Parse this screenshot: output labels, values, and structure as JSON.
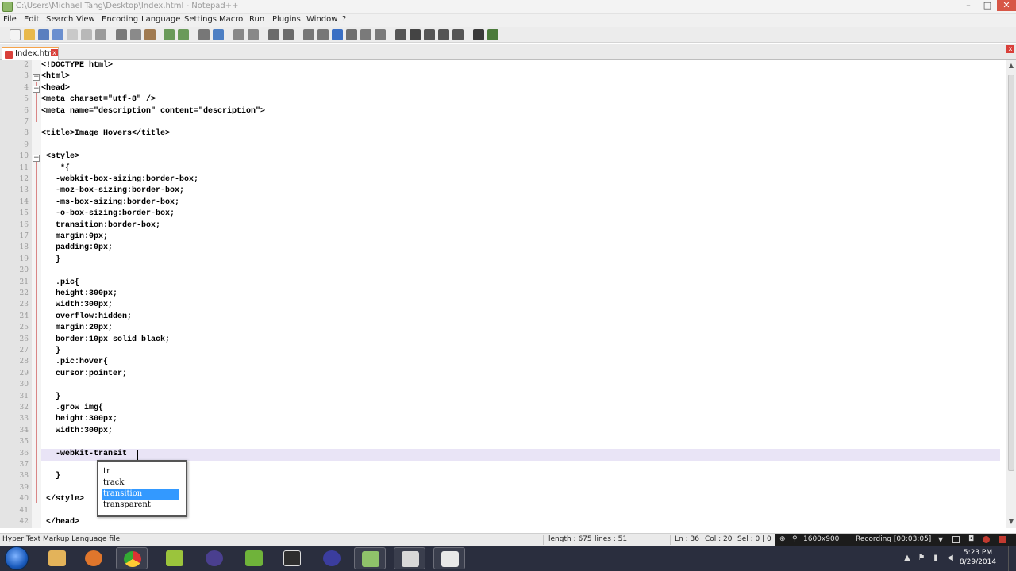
{
  "window": {
    "title": "C:\\Users\\Michael Tang\\Desktop\\Index.html - Notepad++"
  },
  "menu": [
    "File",
    "Edit",
    "Search",
    "View",
    "Encoding",
    "Language",
    "Settings",
    "Macro",
    "Run",
    "Plugins",
    "Window",
    "?"
  ],
  "tab": {
    "label": "Index.html",
    "close": "x"
  },
  "editor": {
    "lines": [
      {
        "num": "2",
        "text": "<!DOCTYPE html>"
      },
      {
        "num": "3",
        "text": "<html>"
      },
      {
        "num": "4",
        "text": "<head>"
      },
      {
        "num": "5",
        "text": "<meta charset=\"utf-8\" />"
      },
      {
        "num": "6",
        "text": "<meta name=\"description\" content=\"description\">"
      },
      {
        "num": "7",
        "text": ""
      },
      {
        "num": "8",
        "text": "<title>Image Hovers</title>"
      },
      {
        "num": "9",
        "text": ""
      },
      {
        "num": "10",
        "text": " <style>"
      },
      {
        "num": "11",
        "text": "    *{"
      },
      {
        "num": "12",
        "text": "   -webkit-box-sizing:border-box;"
      },
      {
        "num": "13",
        "text": "   -moz-box-sizing:border-box;"
      },
      {
        "num": "14",
        "text": "   -ms-box-sizing:border-box;"
      },
      {
        "num": "15",
        "text": "   -o-box-sizing:border-box;"
      },
      {
        "num": "16",
        "text": "   transition:border-box;"
      },
      {
        "num": "17",
        "text": "   margin:0px;"
      },
      {
        "num": "18",
        "text": "   padding:0px;"
      },
      {
        "num": "19",
        "text": "   }"
      },
      {
        "num": "20",
        "text": ""
      },
      {
        "num": "21",
        "text": "   .pic{"
      },
      {
        "num": "22",
        "text": "   height:300px;"
      },
      {
        "num": "23",
        "text": "   width:300px;"
      },
      {
        "num": "24",
        "text": "   overflow:hidden;"
      },
      {
        "num": "25",
        "text": "   margin:20px;"
      },
      {
        "num": "26",
        "text": "   border:10px solid black;"
      },
      {
        "num": "27",
        "text": "   }"
      },
      {
        "num": "28",
        "text": "   .pic:hover{"
      },
      {
        "num": "29",
        "text": "   cursor:pointer;"
      },
      {
        "num": "30",
        "text": ""
      },
      {
        "num": "31",
        "text": "   }"
      },
      {
        "num": "32",
        "text": "   .grow img{"
      },
      {
        "num": "33",
        "text": "   height:300px;"
      },
      {
        "num": "34",
        "text": "   width:300px;"
      },
      {
        "num": "35",
        "text": ""
      },
      {
        "num": "36",
        "text": "   -webkit-transit"
      },
      {
        "num": "37",
        "text": ""
      },
      {
        "num": "38",
        "text": "   }"
      },
      {
        "num": "39",
        "text": ""
      },
      {
        "num": "40",
        "text": " </style>"
      },
      {
        "num": "41",
        "text": ""
      },
      {
        "num": "42",
        "text": " </head>"
      }
    ]
  },
  "autocomplete": {
    "items": [
      "tr",
      "track",
      "transition",
      "transparent"
    ],
    "selected": "transition"
  },
  "status": {
    "file_type": "Hyper Text Markup Language file",
    "length": "length : 675",
    "lines": "lines : 51",
    "position": "Ln : 36",
    "col": "Col : 20",
    "sel": "Sel : 0 | 0",
    "resolution": "1600x900",
    "recording": "Recording [00:03:05]"
  },
  "clock": {
    "time": "5:23 PM",
    "date": "8/29/2014"
  },
  "colors": {
    "selection": "#3399ff",
    "active_line": "#e9e4f6",
    "taskbar": "#2a2e3e"
  }
}
